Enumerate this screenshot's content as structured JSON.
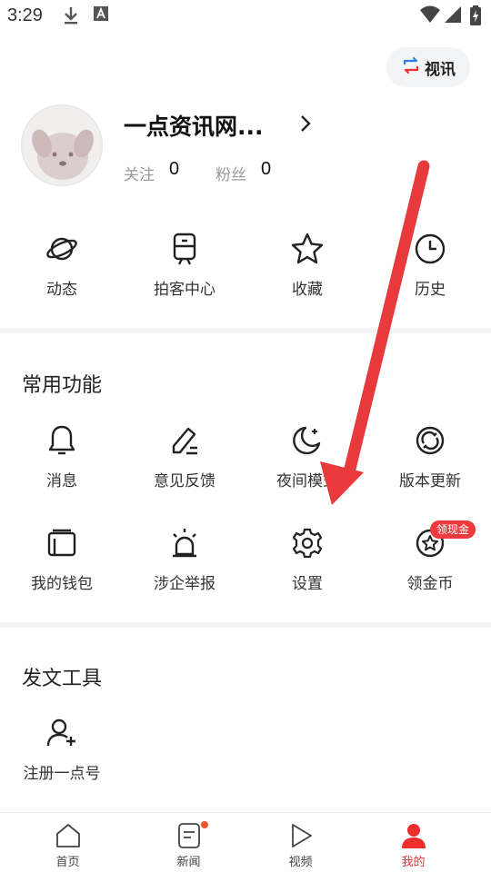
{
  "status_bar": {
    "time": "3:29"
  },
  "header": {
    "video_button_label": "视讯"
  },
  "profile": {
    "name": "一点资讯网...",
    "following_label": "关注",
    "following_count": "0",
    "fans_label": "粉丝",
    "fans_count": "0"
  },
  "quick_actions": [
    {
      "label": "动态",
      "icon": "planet-icon"
    },
    {
      "label": "拍客中心",
      "icon": "camera-center-icon"
    },
    {
      "label": "收藏",
      "icon": "star-icon"
    },
    {
      "label": "历史",
      "icon": "clock-icon"
    }
  ],
  "common_functions": {
    "title": "常用功能",
    "items": [
      {
        "label": "消息",
        "icon": "bell-icon"
      },
      {
        "label": "意见反馈",
        "icon": "feedback-pen-icon"
      },
      {
        "label": "夜间模式",
        "icon": "moon-icon"
      },
      {
        "label": "版本更新",
        "icon": "refresh-icon"
      },
      {
        "label": "我的钱包",
        "icon": "wallet-icon"
      },
      {
        "label": "涉企举报",
        "icon": "alarm-icon"
      },
      {
        "label": "设置",
        "icon": "gear-icon"
      },
      {
        "label": "领金币",
        "icon": "coin-star-icon"
      }
    ],
    "coin_badge": "领现金"
  },
  "publish_tools": {
    "title": "发文工具",
    "items": [
      {
        "label": "注册一点号",
        "icon": "add-user-icon"
      }
    ]
  },
  "bottom_nav": [
    {
      "label": "首页",
      "icon": "home-icon"
    },
    {
      "label": "新闻",
      "icon": "news-icon"
    },
    {
      "label": "视频",
      "icon": "play-icon"
    },
    {
      "label": "我的",
      "icon": "person-icon",
      "active": true
    }
  ],
  "colors": {
    "accent": "#ee2d2d",
    "annotation_arrow": "#e8393c"
  }
}
